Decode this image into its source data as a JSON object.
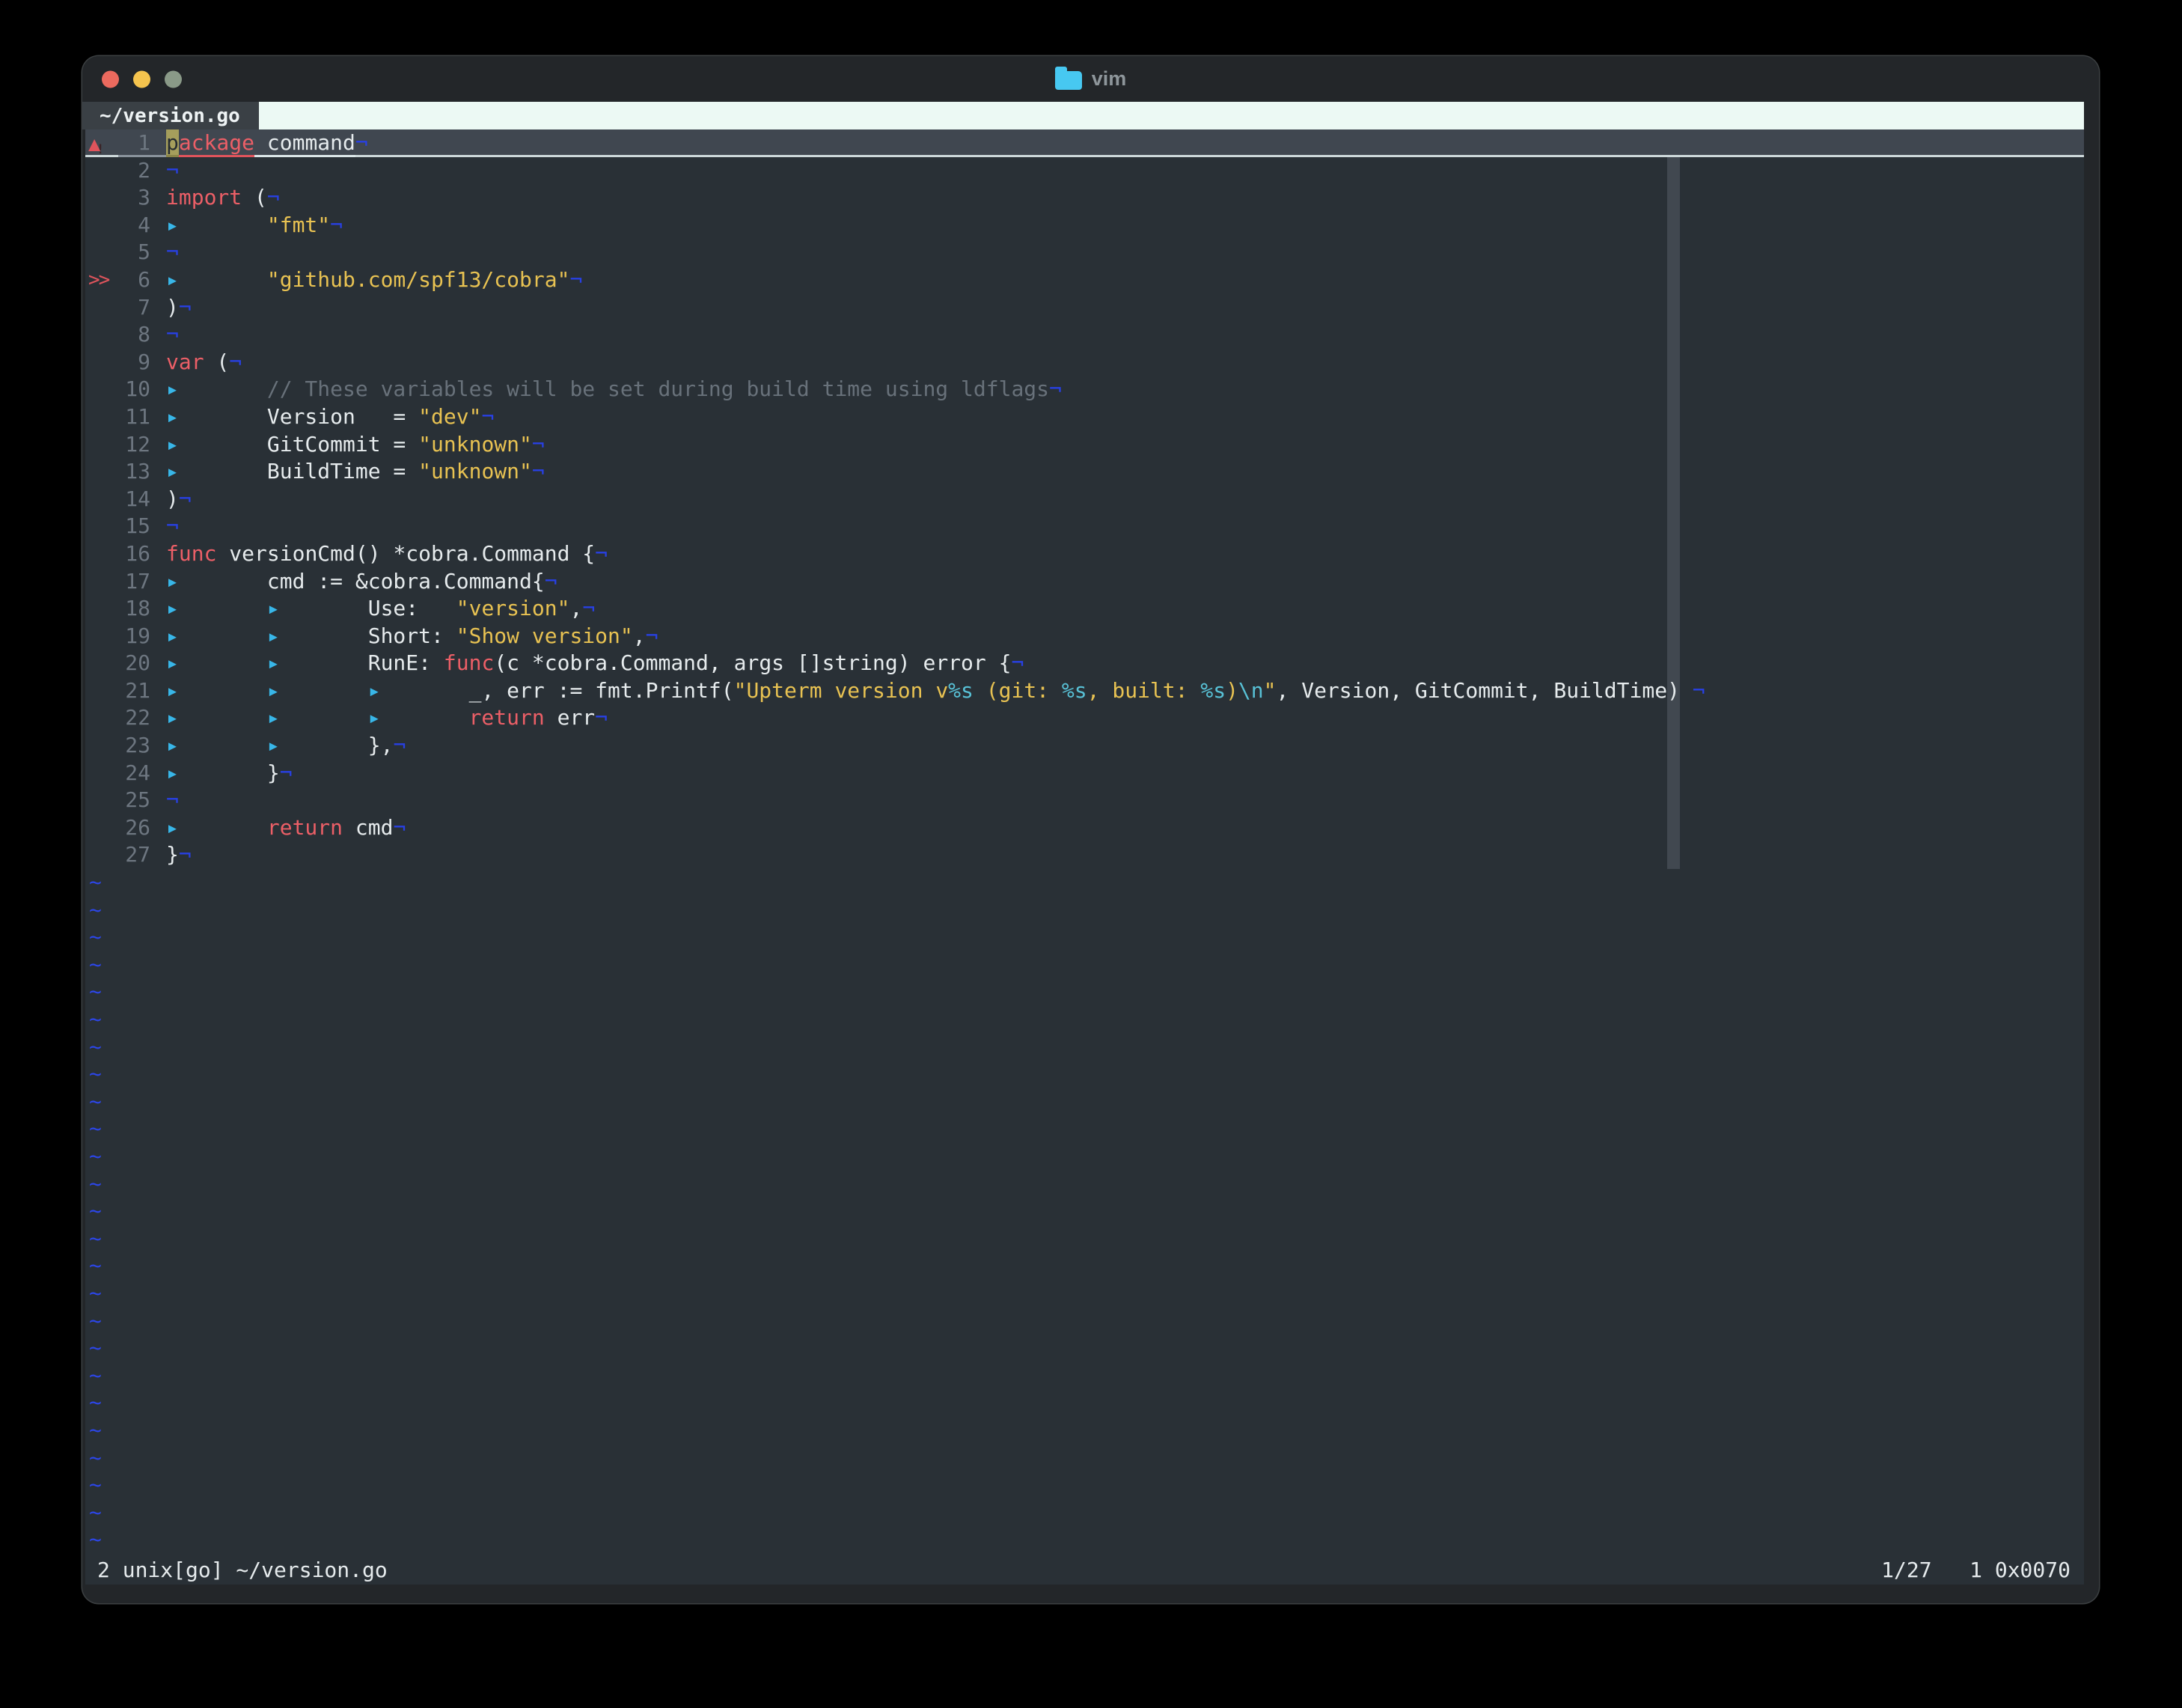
{
  "titlebar": {
    "title": "vim"
  },
  "tabbar": {
    "active_tab": "~/version.go"
  },
  "statusbar": {
    "left": "2 unix[go] ~/version.go",
    "right": "1/27   1 0x0070"
  },
  "colors": {
    "background": "#000000",
    "frame": "#232629",
    "terminal_bg": "#293036",
    "cursorline_bg": "#404750",
    "tabbar_light": "#ecf9f4",
    "keyword_red": "#ec5f67",
    "string_yellow": "#e8c252",
    "format_cyan": "#58c1d6",
    "comment_gray": "#68717a",
    "eol_blue": "#2840e4",
    "sign_red": "#e0545c",
    "traffic_red": "#ec6a5e",
    "traffic_yellow": "#f5c44e",
    "traffic_green": "#8a9a88",
    "folder_blue": "#47c8f1"
  },
  "editor": {
    "eol_char": "¬",
    "tab_char": "▸",
    "tilde_char": "~",
    "filler_count": 25,
    "signs": {
      "warn_triangle": "▲",
      "warn_bang": "!",
      "chev": ">>"
    },
    "lines": [
      {
        "n": 1,
        "sign": "warn",
        "cursorline": true,
        "segs": [
          [
            "cursor",
            "p"
          ],
          [
            "spell",
            "ackage"
          ],
          [
            "und",
            " command"
          ],
          [
            "eol"
          ]
        ]
      },
      {
        "n": 2,
        "segs": [
          [
            "eol"
          ]
        ]
      },
      {
        "n": 3,
        "segs": [
          [
            "kw",
            "import"
          ],
          [
            "txt",
            " ("
          ],
          [
            "eol"
          ]
        ]
      },
      {
        "n": 4,
        "segs": [
          [
            "tab"
          ],
          [
            "str",
            "\"fmt\""
          ],
          [
            "eol"
          ]
        ]
      },
      {
        "n": 5,
        "segs": [
          [
            "eol"
          ]
        ]
      },
      {
        "n": 6,
        "sign": "chev",
        "segs": [
          [
            "tab"
          ],
          [
            "str",
            "\"github.com/spf13/cobra\""
          ],
          [
            "eol"
          ]
        ]
      },
      {
        "n": 7,
        "segs": [
          [
            "txt",
            ")"
          ],
          [
            "eol"
          ]
        ]
      },
      {
        "n": 8,
        "segs": [
          [
            "eol"
          ]
        ]
      },
      {
        "n": 9,
        "segs": [
          [
            "kw",
            "var"
          ],
          [
            "txt",
            " ("
          ],
          [
            "eol"
          ]
        ]
      },
      {
        "n": 10,
        "segs": [
          [
            "tab"
          ],
          [
            "com",
            "// These variables will be set during build time using ldflags"
          ],
          [
            "eol"
          ]
        ]
      },
      {
        "n": 11,
        "segs": [
          [
            "tab"
          ],
          [
            "txt",
            "Version   = "
          ],
          [
            "str",
            "\"dev\""
          ],
          [
            "eol"
          ]
        ]
      },
      {
        "n": 12,
        "segs": [
          [
            "tab"
          ],
          [
            "txt",
            "GitCommit = "
          ],
          [
            "str",
            "\"unknown\""
          ],
          [
            "eol"
          ]
        ]
      },
      {
        "n": 13,
        "segs": [
          [
            "tab"
          ],
          [
            "txt",
            "BuildTime = "
          ],
          [
            "str",
            "\"unknown\""
          ],
          [
            "eol"
          ]
        ]
      },
      {
        "n": 14,
        "segs": [
          [
            "txt",
            ")"
          ],
          [
            "eol"
          ]
        ]
      },
      {
        "n": 15,
        "segs": [
          [
            "eol"
          ]
        ]
      },
      {
        "n": 16,
        "segs": [
          [
            "kw",
            "func"
          ],
          [
            "txt",
            " versionCmd() *cobra.Command {"
          ],
          [
            "eol"
          ]
        ]
      },
      {
        "n": 17,
        "segs": [
          [
            "tab"
          ],
          [
            "txt",
            "cmd := &cobra.Command{"
          ],
          [
            "eol"
          ]
        ]
      },
      {
        "n": 18,
        "segs": [
          [
            "tab"
          ],
          [
            "tab"
          ],
          [
            "txt",
            "Use:   "
          ],
          [
            "str",
            "\"version\""
          ],
          [
            "txt",
            ","
          ],
          [
            "eol"
          ]
        ]
      },
      {
        "n": 19,
        "segs": [
          [
            "tab"
          ],
          [
            "tab"
          ],
          [
            "txt",
            "Short: "
          ],
          [
            "str",
            "\"Show version\""
          ],
          [
            "txt",
            ","
          ],
          [
            "eol"
          ]
        ]
      },
      {
        "n": 20,
        "segs": [
          [
            "tab"
          ],
          [
            "tab"
          ],
          [
            "txt",
            "RunE: "
          ],
          [
            "kw",
            "func"
          ],
          [
            "txt",
            "(c *cobra.Command, args []string) error {"
          ],
          [
            "eol"
          ]
        ]
      },
      {
        "n": 21,
        "segs": [
          [
            "tab"
          ],
          [
            "tab"
          ],
          [
            "tab"
          ],
          [
            "txt",
            "_, err := fmt.Printf("
          ],
          [
            "str",
            "\"Upterm version v"
          ],
          [
            "fmt",
            "%s"
          ],
          [
            "str",
            " (git: "
          ],
          [
            "fmt",
            "%s"
          ],
          [
            "str",
            ", built: "
          ],
          [
            "fmt",
            "%s"
          ],
          [
            "str",
            ")"
          ],
          [
            "fmt",
            "\\n"
          ],
          [
            "str",
            "\""
          ],
          [
            "txt",
            ", Version, GitCommit, BuildTime)"
          ],
          [
            "sp"
          ],
          [
            "eol"
          ]
        ]
      },
      {
        "n": 22,
        "segs": [
          [
            "tab"
          ],
          [
            "tab"
          ],
          [
            "tab"
          ],
          [
            "kw",
            "return"
          ],
          [
            "txt",
            " err"
          ],
          [
            "eol"
          ]
        ]
      },
      {
        "n": 23,
        "segs": [
          [
            "tab"
          ],
          [
            "tab"
          ],
          [
            "txt",
            "},"
          ],
          [
            "eol"
          ]
        ]
      },
      {
        "n": 24,
        "segs": [
          [
            "tab"
          ],
          [
            "txt",
            "}"
          ],
          [
            "eol"
          ]
        ]
      },
      {
        "n": 25,
        "segs": [
          [
            "eol"
          ]
        ]
      },
      {
        "n": 26,
        "segs": [
          [
            "tab"
          ],
          [
            "kw",
            "return"
          ],
          [
            "txt",
            " cmd"
          ],
          [
            "eol"
          ]
        ]
      },
      {
        "n": 27,
        "segs": [
          [
            "txt",
            "}"
          ],
          [
            "eol"
          ]
        ]
      }
    ]
  }
}
